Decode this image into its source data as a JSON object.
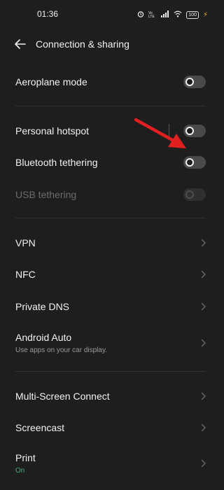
{
  "status_bar": {
    "time": "01:36",
    "battery": "100"
  },
  "header": {
    "title": "Connection & sharing"
  },
  "rows": [
    {
      "label": "Aeroplane mode"
    },
    {
      "label": "Personal hotspot"
    },
    {
      "label": "Bluetooth tethering"
    },
    {
      "label": "USB tethering"
    },
    {
      "label": "VPN"
    },
    {
      "label": "NFC"
    },
    {
      "label": "Private DNS"
    },
    {
      "label": "Android Auto",
      "subtitle": "Use apps on your car display."
    },
    {
      "label": "Multi-Screen Connect"
    },
    {
      "label": "Screencast"
    },
    {
      "label": "Print",
      "subtitle": "On"
    }
  ],
  "colors": {
    "background": "#1e1e1e",
    "on_status": "#3fb07a",
    "annotation_arrow": "#e02020"
  }
}
